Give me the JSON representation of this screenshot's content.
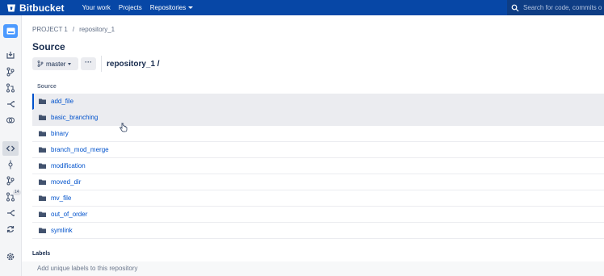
{
  "topnav": {
    "brand": "Bitbucket",
    "links": [
      "Your work",
      "Projects",
      "Repositories"
    ],
    "search_placeholder": "Search for code, commits o"
  },
  "breadcrumb": {
    "project": "PROJECT 1",
    "separator": "/",
    "repo": "repository_1"
  },
  "page": {
    "title": "Source",
    "branch": "master",
    "more": "···",
    "path": "repository_1 /"
  },
  "table": {
    "header": "Source",
    "files": [
      "add_file",
      "basic_branching",
      "binary",
      "branch_mod_merge",
      "modification",
      "moved_dir",
      "mv_file",
      "out_of_order",
      "symlink"
    ]
  },
  "labels": {
    "title": "Labels",
    "hint": "Add unique labels to this repository"
  },
  "sidebar": {
    "badge": "14"
  },
  "colors": {
    "topnav": "#0747a6",
    "link": "#0052cc",
    "sidebar": "#f4f5f7"
  }
}
